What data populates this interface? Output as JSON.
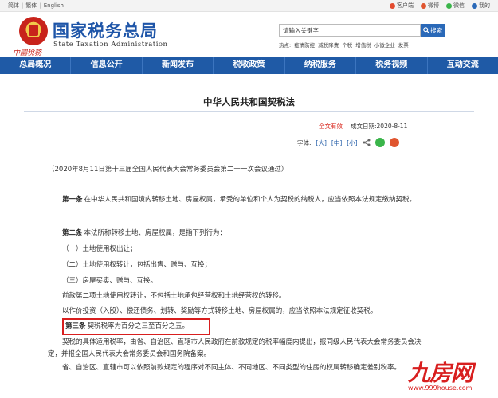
{
  "topbar": {
    "lang": [
      "简体",
      "繁体",
      "English"
    ],
    "links": [
      {
        "label": "客户端",
        "color": "#e34b2f",
        "icon": "mobile-icon"
      },
      {
        "label": "微博",
        "color": "#e0552f",
        "icon": "weibo-icon"
      },
      {
        "label": "微信",
        "color": "#3ab54a",
        "icon": "wechat-icon"
      },
      {
        "label": "我的",
        "color": "#2a69b8",
        "icon": "user-icon"
      }
    ]
  },
  "header": {
    "slogan": "中國稅務",
    "title": "国家税务总局",
    "subtitle": "State Taxation Administration",
    "search_placeholder": "请输入关键字",
    "search_button": "搜索",
    "hot_label": "热点:",
    "hot": [
      "疫情防控",
      "减税降费",
      "个税",
      "增值税",
      "小微企业",
      "发票"
    ]
  },
  "nav": [
    "总局概况",
    "信息公开",
    "新闻发布",
    "税收政策",
    "纳税服务",
    "税务视频",
    "互动交流"
  ],
  "article": {
    "title": "中华人民共和国契税法",
    "status": "全文有效",
    "date": "成文日期:2020-8-11",
    "font_label": "字体:",
    "font_sizes": [
      "[大]",
      "[中]",
      "[小]"
    ],
    "intro": "（2020年8月11日第十三届全国人民代表大会常务委员会第二十一次会议通过）",
    "art1_label": "第一条",
    "art1_text": "在中华人民共和国境内转移土地、房屋权属，承受的单位和个人为契税的纳税人，应当依照本法规定缴纳契税。",
    "art2_label": "第二条",
    "art2_text": "本法所称转移土地、房屋权属，是指下列行为：",
    "item1": "（一）土地使用权出让；",
    "item2": "（二）土地使用权转让，包括出售、赠与、互换；",
    "item3": "（三）房屋买卖、赠与、互换。",
    "p_exclude": "前款第二项土地使用权转让，不包括土地承包经营权和土地经营权的转移。",
    "p_other": "以作价投资（入股）、偿还债务、划转、奖励等方式转移土地、房屋权属的，应当依照本法规定征收契税。",
    "art3_label": "第三条",
    "art3_text": "契税税率为百分之三至百分之五。",
    "p_rate": "契税的具体适用税率，由省、自治区、直辖市人民政府在前款规定的税率幅度内提出，报同级人民代表大会常务委员会决定，并报全国人民代表大会常务委员会和国务院备案。",
    "p_diff": "省、自治区、直辖市可以依照前款规定的程序对不同主体、不同地区、不同类型的住房的权属转移确定差别税率。"
  },
  "watermark": {
    "brand": "九房网",
    "url": "www.999house.com"
  },
  "colors": {
    "brand_blue": "#1f5aa6",
    "accent_red": "#d81e1e"
  }
}
